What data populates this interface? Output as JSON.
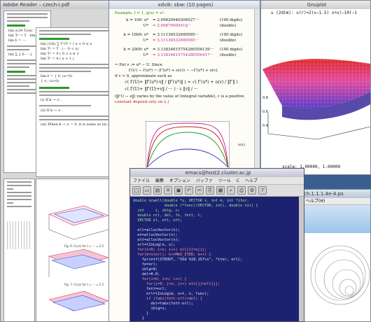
{
  "adobe": {
    "title": "Adobe Reader – czech-i.pdf",
    "proposition13": "Proposition 13",
    "proposition14": "Proposition 14",
    "fig_caption_1": "Fig. 6. C(x,t) for t = ··· = 2.5",
    "fig_caption_2": "Fig. 7. C(x,t) for t = ··· = 2.5",
    "fig_caption_3": "Fig. 8. C(x,t) for t = ··· = 2.5"
  },
  "xdvik": {
    "title": "xdvik: sbw:  (10 pages)",
    "example": "Example.  f = 1,  g(u) = u³.",
    "rows": [
      {
        "k": "k = 100:  u*",
        "v": "= 2.09820940206527···",
        "note": "(100 digits)"
      },
      {
        "k": "U*",
        "v": "= 2.09870005410̱̱···",
        "note": "(double)"
      },
      {
        "k": "k = 1000:  u*",
        "v": "= 3.11136532690585···",
        "note": "(100 digits)"
      },
      {
        "k": "U*",
        "v": "= 3.11136532690585···",
        "note": "(double)"
      },
      {
        "k": "k = 2000:  u*",
        "v": "= 3.13834615754280556139···",
        "note": "(100 digits)"
      },
      {
        "k": "U*",
        "v": "= 3.13834615754280556417···",
        "note": "(double)"
      }
    ],
    "put": "Put  v := u* − U.  Since",
    "eq1": "f′(U) − f′(u*) ~ (f″(u*) + o(v)) ~ −f″(u*) + o(v),",
    "ifv": "if v ≈ 0, approximate such as",
    "note": "(‖f·U − e‖) varies by the value of (integral variable), c is a positive",
    "note2": "constant depend only on  λ.)",
    "axis_label": "u(x)"
  },
  "gnuplot": {
    "title": "Gnuplot",
    "header": "u (2dim):  u(r)=2(x−1.5) x+u(−10(−1",
    "scale": "scale:  1.00000,  1.00000"
  },
  "emacs": {
    "title": "emacs@host2.cluster.ac.jp",
    "menu": [
      "ファイル",
      "編集",
      "オプション",
      "バッファ",
      "ツール",
      "C",
      "ヘルプ"
    ],
    "code": [
      "double ncwell(double *u, VECTOR x, int m, int *iter,",
      "              double (*func)(VECTOR, int), double tol) {",
      "  int     i, iblg, n;",
      "  double nrl, del, fe, fett, t;",
      "  VECTOR el, ett, ett;",
      "",
      "  ell=allocVector(n);",
      "  et=allocVector(n);",
      "  ett=allocVector(n);",
      "  nrl=lInLog(n, x);",
      "  for(i=0; i<n; i++) ell[i]=u[i];",
      "  for(k=iter(); k<=MAX_ITER; k++) {",
      "    fprintf(STDOUT, \"%5d %18.15f\\n\", *iter, nrl);",
      "    fe=nrl;",
      "    iblg=0;",
      "    del=0.0;",
      "    for(i=0; i<n; i++) {",
      "      for(j=0; j<n; j++) ett[j]=ell[j];",
      "      fett=nrl;",
      "      nrl=lInLog(m, x+t, n, func);",
      "      if (fabs(fett-nrl)>del) {",
      "        del=fabs(fett-nrl);",
      "        iblg=i;",
      "      }",
      "    }",
      "    if (2.0*fabs(fe-nrl)<=tol*(fabs(fe)+fabs(nrl))) {",
      "      freeVector(ell);",
      "      freeVector(et);"
    ]
  },
  "viewer": {
    "title": "ch.1.1.1.4e-4.ps",
    "menu": "ヘルプ(H)"
  }
}
